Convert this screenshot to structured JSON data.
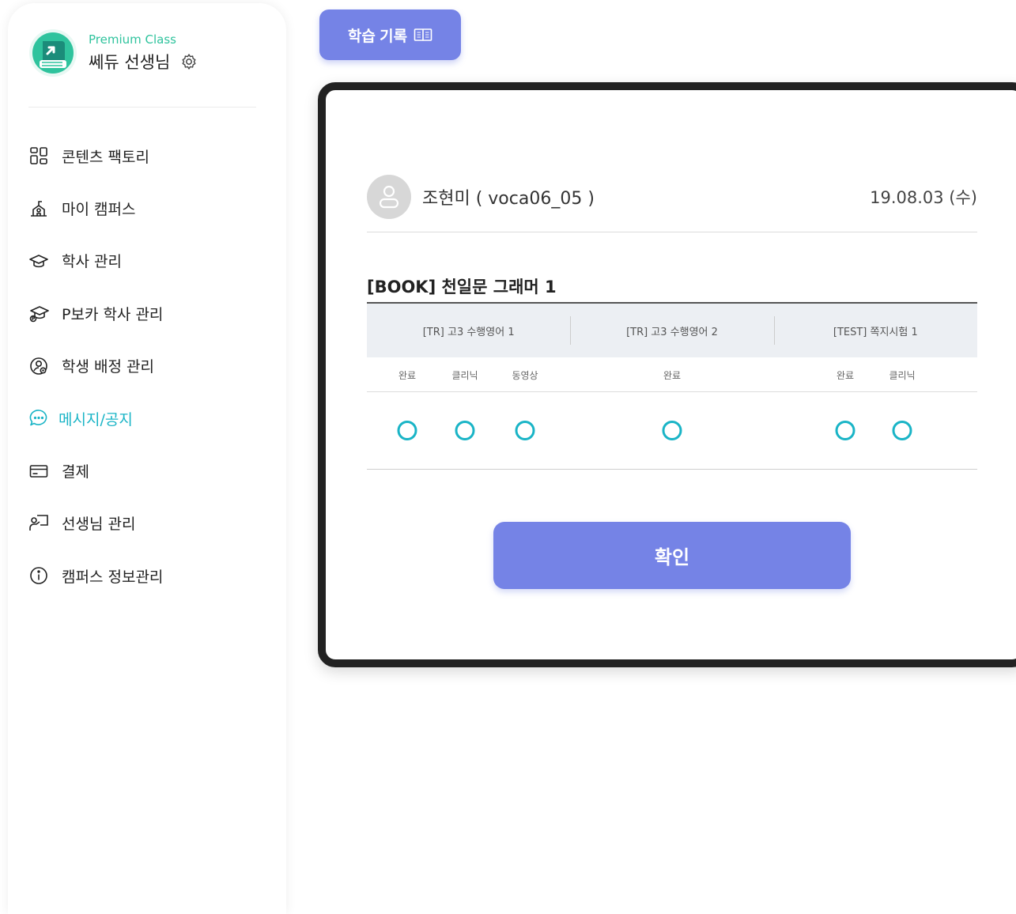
{
  "profile": {
    "class_label": "Premium Class",
    "teacher_name": "쎄듀 선생님"
  },
  "sidebar": {
    "items": [
      {
        "label": "콘텐츠 팩토리",
        "icon": "grid-icon"
      },
      {
        "label": "마이 캠퍼스",
        "icon": "campus-icon"
      },
      {
        "label": "학사 관리",
        "icon": "graduation-cap-icon"
      },
      {
        "label": "P보카 학사 관리",
        "icon": "graduation-cap-p-icon"
      },
      {
        "label": "학생 배정 관리",
        "icon": "user-assign-icon"
      },
      {
        "label": "메시지/공지",
        "icon": "message-icon",
        "active": true
      },
      {
        "label": "결제",
        "icon": "card-icon"
      },
      {
        "label": "선생님 관리",
        "icon": "teacher-board-icon"
      },
      {
        "label": "캠퍼스 정보관리",
        "icon": "info-icon"
      }
    ]
  },
  "record_button": {
    "label": "학습 기록",
    "icon": "book-icon"
  },
  "student": {
    "name": "조현미 ( voca06_05 )",
    "date": "19.08.03 (수)"
  },
  "book_title": "[BOOK] 천일문 그래머 1",
  "table": {
    "groups": [
      {
        "label": "[TR] 고3 수행영어 1",
        "columns": [
          "완료",
          "클리닉",
          "동영상"
        ]
      },
      {
        "label": "[TR] 고3 수행영어 2",
        "columns": [
          "완료"
        ]
      },
      {
        "label": "[TEST] 쪽지시험 1",
        "columns": [
          "완료",
          "클리닉"
        ]
      }
    ],
    "mark_symbol": "circle",
    "colors": {
      "mark": "#19b4c6",
      "header_bg": "#eceff3"
    }
  },
  "confirm_button": {
    "label": "확인"
  },
  "colors": {
    "accent": "#7583e6",
    "active": "#19b4c6",
    "premium": "#2fc39d"
  }
}
